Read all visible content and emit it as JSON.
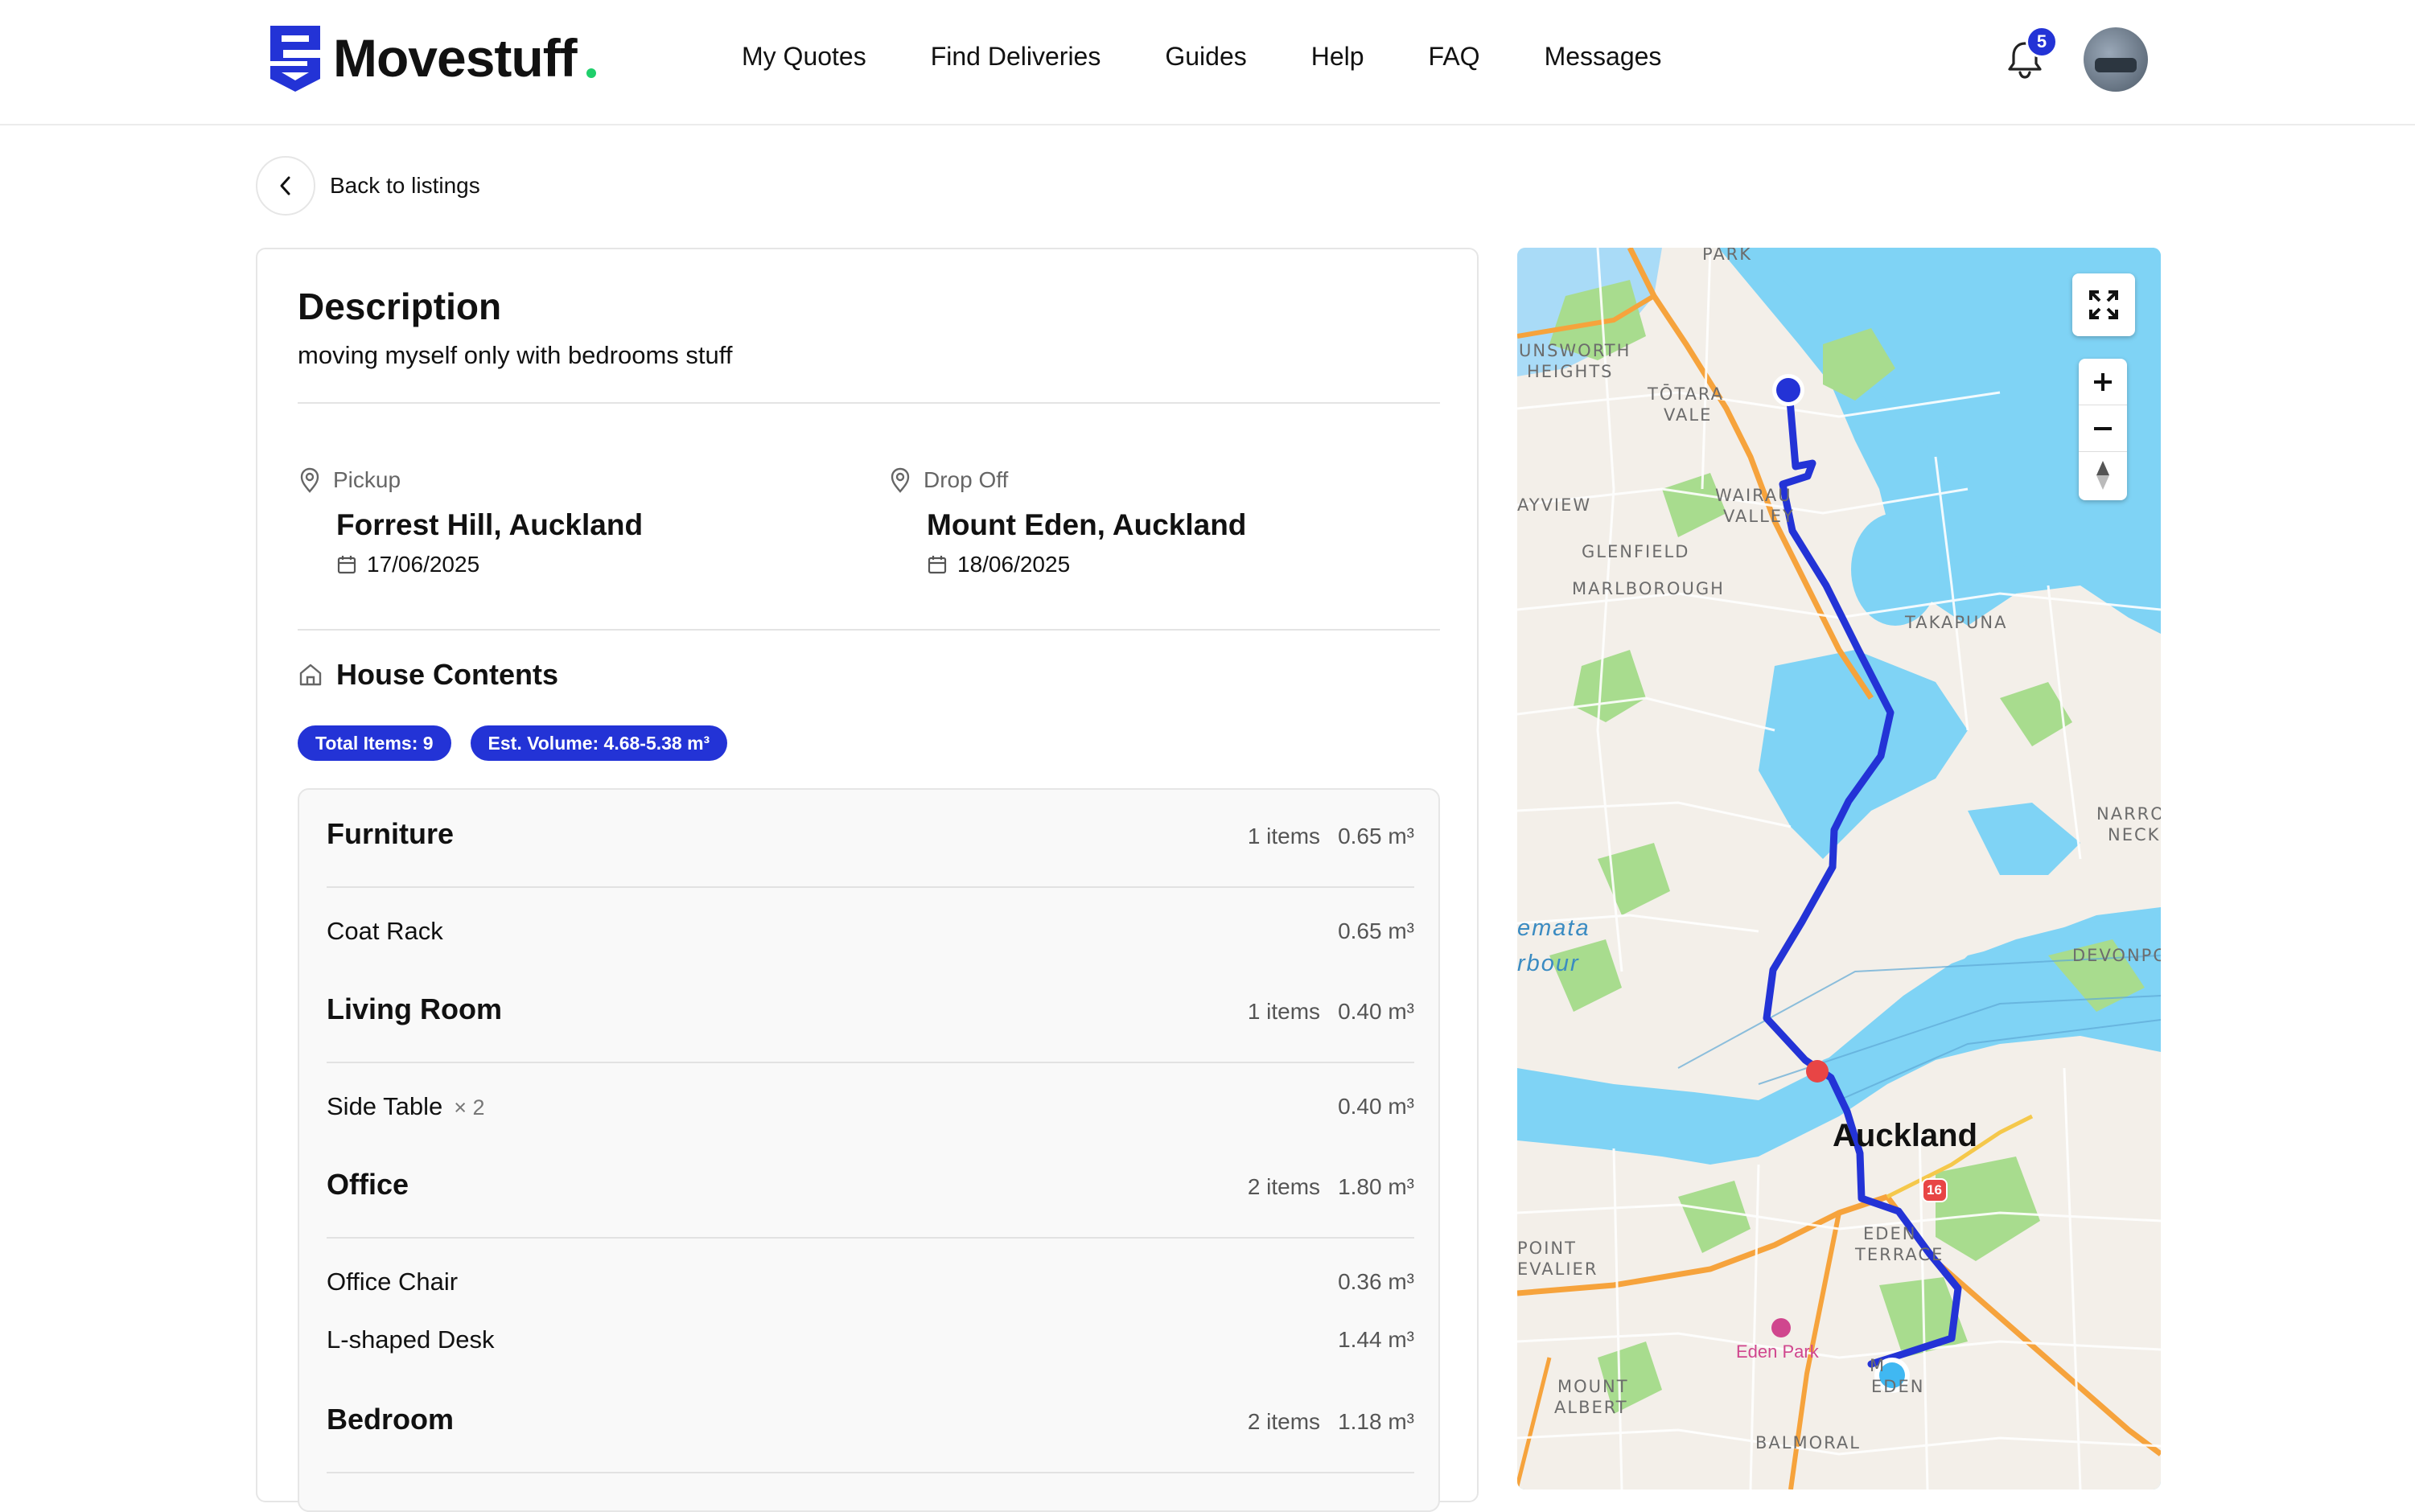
{
  "brand": {
    "name": "Movestuff"
  },
  "nav": [
    "My Quotes",
    "Find Deliveries",
    "Guides",
    "Help",
    "FAQ",
    "Messages"
  ],
  "notifications": {
    "count": "5"
  },
  "back": {
    "label": "Back to listings"
  },
  "description": {
    "title": "Description",
    "text": "moving myself only with bedrooms stuff"
  },
  "pickup": {
    "label": "Pickup",
    "place": "Forrest Hill, Auckland",
    "date": "17/06/2025"
  },
  "dropoff": {
    "label": "Drop Off",
    "place": "Mount Eden, Auckland",
    "date": "18/06/2025"
  },
  "house_contents": {
    "title": "House Contents",
    "total_items": "Total Items: 9",
    "est_volume": "Est. Volume: 4.68-5.38 m³",
    "categories": [
      {
        "name": "Furniture",
        "count": "1 items",
        "volume": "0.65 m³",
        "items": [
          {
            "name": "Coat Rack",
            "qty": "",
            "volume": "0.65 m³"
          }
        ]
      },
      {
        "name": "Living Room",
        "count": "1 items",
        "volume": "0.40 m³",
        "items": [
          {
            "name": "Side Table",
            "qty": "× 2",
            "volume": "0.40 m³"
          }
        ]
      },
      {
        "name": "Office",
        "count": "2 items",
        "volume": "1.80 m³",
        "items": [
          {
            "name": "Office Chair",
            "qty": "",
            "volume": "0.36 m³"
          },
          {
            "name": "L-shaped Desk",
            "qty": "",
            "volume": "1.44 m³"
          }
        ]
      },
      {
        "name": "Bedroom",
        "count": "2 items",
        "volume": "1.18 m³",
        "items": []
      }
    ]
  },
  "map": {
    "labels": {
      "park": "PARK",
      "unsworth": "UNSWORTH",
      "heights": "HEIGHTS",
      "totara": "TŌTARA",
      "vale": "VALE",
      "bayview": "AYVIEW",
      "wairau": "WAIRAU",
      "valley": "VALLEY",
      "glenfield": "GLENFIELD",
      "marlborough": "MARLBOROUGH",
      "takapuna": "TAKAPUNA",
      "narrow": "NARRO",
      "neck": "NECK",
      "devonport": "DEVONPO",
      "point": "POINT",
      "chevalier": "EVALIER",
      "eden_terrace_1": "EDEN",
      "eden_terrace_2": "TERRACE",
      "mount_albert_1": "MOUNT",
      "mount_albert_2": "ALBERT",
      "mt_eden_1": "M",
      "mt_eden_2": "EDEN",
      "balmoral": "BALMORAL",
      "harbour_1": "emata",
      "harbour_2": "rbour",
      "city": "Auckland",
      "poi": "Eden Park",
      "shield": "16"
    },
    "colors": {
      "route": "#2333d6",
      "water": "#7fd3f5",
      "land": "#f3efe9",
      "park": "#a8dc8e",
      "motorway": "#f6a33c"
    }
  }
}
